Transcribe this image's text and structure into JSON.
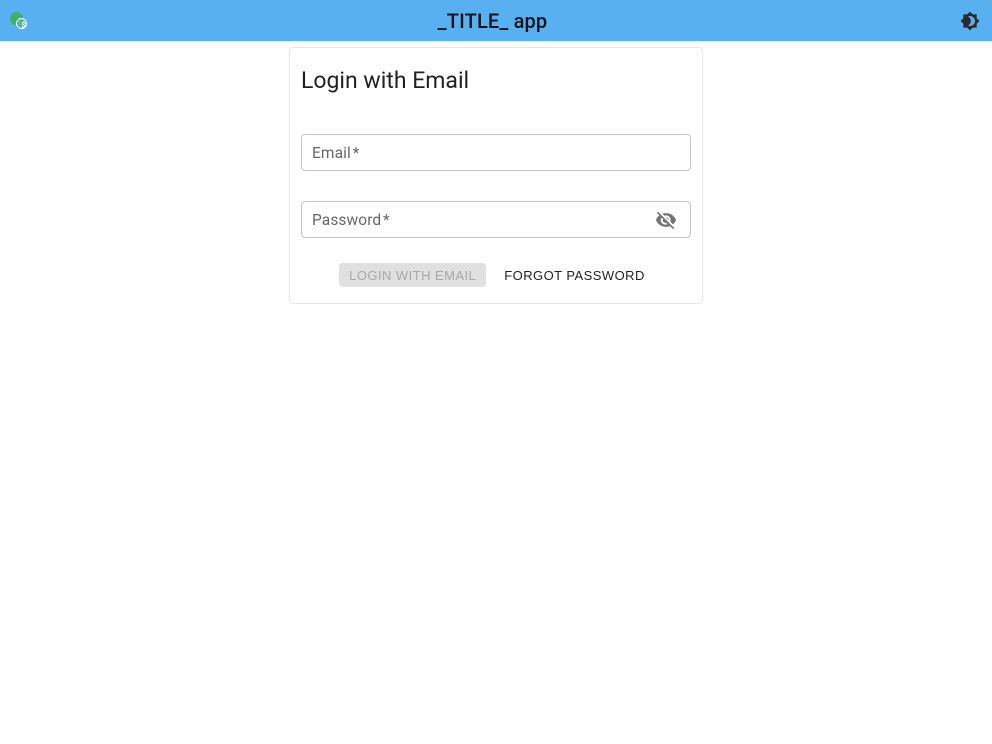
{
  "header": {
    "title": "_TITLE_ app"
  },
  "login": {
    "card_title": "Login with Email",
    "email_label": "Email",
    "email_required": "*",
    "password_label": "Password",
    "password_required": "*",
    "login_button_label": "LOGIN WITH EMAIL",
    "forgot_button_label": "FORGOT PASSWORD"
  }
}
